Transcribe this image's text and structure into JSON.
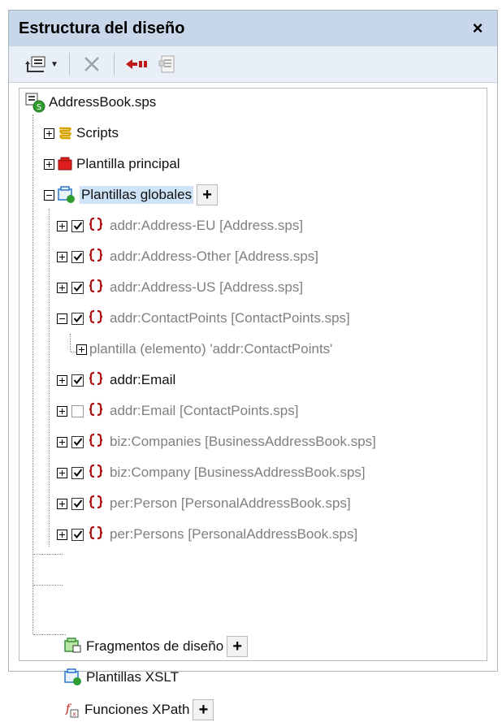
{
  "window": {
    "title": "Estructura del diseño",
    "close_label": "×"
  },
  "toolbar": {
    "buttons": [
      {
        "name": "add-item-button",
        "icon": "add-schema-icon"
      },
      {
        "name": "delete-button",
        "icon": "delete-icon"
      },
      {
        "name": "collapse-button",
        "icon": "arrow-back-icon"
      },
      {
        "name": "properties-button",
        "icon": "sheet-icon"
      }
    ]
  },
  "tree": {
    "root": "AddressBook.sps",
    "scripts": "Scripts",
    "main_template": "Plantilla principal",
    "global_templates": "Plantillas globales",
    "items": [
      {
        "label": "addr:Address-EU [Address.sps]",
        "checked": true,
        "expander": "plus",
        "gray": true
      },
      {
        "label": "addr:Address-Other [Address.sps]",
        "checked": true,
        "expander": "plus",
        "gray": true
      },
      {
        "label": "addr:Address-US [Address.sps]",
        "checked": true,
        "expander": "plus",
        "gray": true
      },
      {
        "label": "addr:ContactPoints [ContactPoints.sps]",
        "checked": true,
        "expander": "minus",
        "gray": true
      },
      {
        "label": "addr:Email",
        "checked": true,
        "expander": "plus",
        "gray": false
      },
      {
        "label": "addr:Email [ContactPoints.sps]",
        "checked": false,
        "expander": "plus",
        "gray": true
      },
      {
        "label": "biz:Companies [BusinessAddressBook.sps]",
        "checked": true,
        "expander": "plus",
        "gray": true
      },
      {
        "label": "biz:Company [BusinessAddressBook.sps]",
        "checked": true,
        "expander": "plus",
        "gray": true
      },
      {
        "label": "per:Person [PersonalAddressBook.sps]",
        "checked": true,
        "expander": "plus",
        "gray": true
      },
      {
        "label": "per:Persons [PersonalAddressBook.sps]",
        "checked": true,
        "expander": "plus",
        "gray": true
      }
    ],
    "sub_item": "plantilla (elemento) 'addr:ContactPoints'",
    "fragments": "Fragmentos de diseño",
    "xslt": "Plantillas XSLT",
    "xpath": "Funciones XPath",
    "add_symbol": "+"
  }
}
